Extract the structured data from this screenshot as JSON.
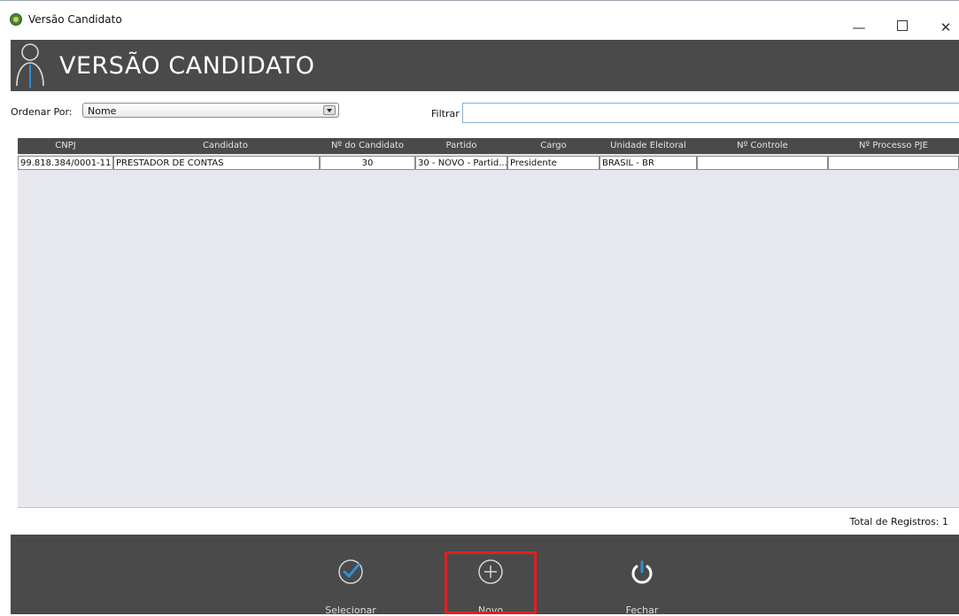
{
  "window": {
    "title": "Versão Candidato",
    "minimize": "—",
    "close": "✕"
  },
  "header": {
    "title": "VERSÃO CANDIDATO"
  },
  "toolbar": {
    "order_label": "Ordenar Por:",
    "order_value": "Nome",
    "filter_label": "Filtrar",
    "filter_value": ""
  },
  "table": {
    "columns": [
      "CNPJ",
      "Candidato",
      "Nº do Candidato",
      "Partido",
      "Cargo",
      "Unidade Eleitoral",
      "Nº Controle",
      "Nº Processo PJE"
    ],
    "rows": [
      [
        "99.818.384/0001-11",
        "PRESTADOR DE CONTAS",
        "30",
        "30 - NOVO - Partid...",
        "Presidente",
        "BRASIL - BR",
        "",
        ""
      ]
    ]
  },
  "status": {
    "total": "Total de Registros: 1"
  },
  "footer": {
    "select_label": "Selecionar",
    "new_label": "Novo",
    "close_label": "Fechar"
  },
  "colors": {
    "header_bg": "#4a4a4a",
    "highlight": "#e02020",
    "accent": "#2f8fd6"
  }
}
